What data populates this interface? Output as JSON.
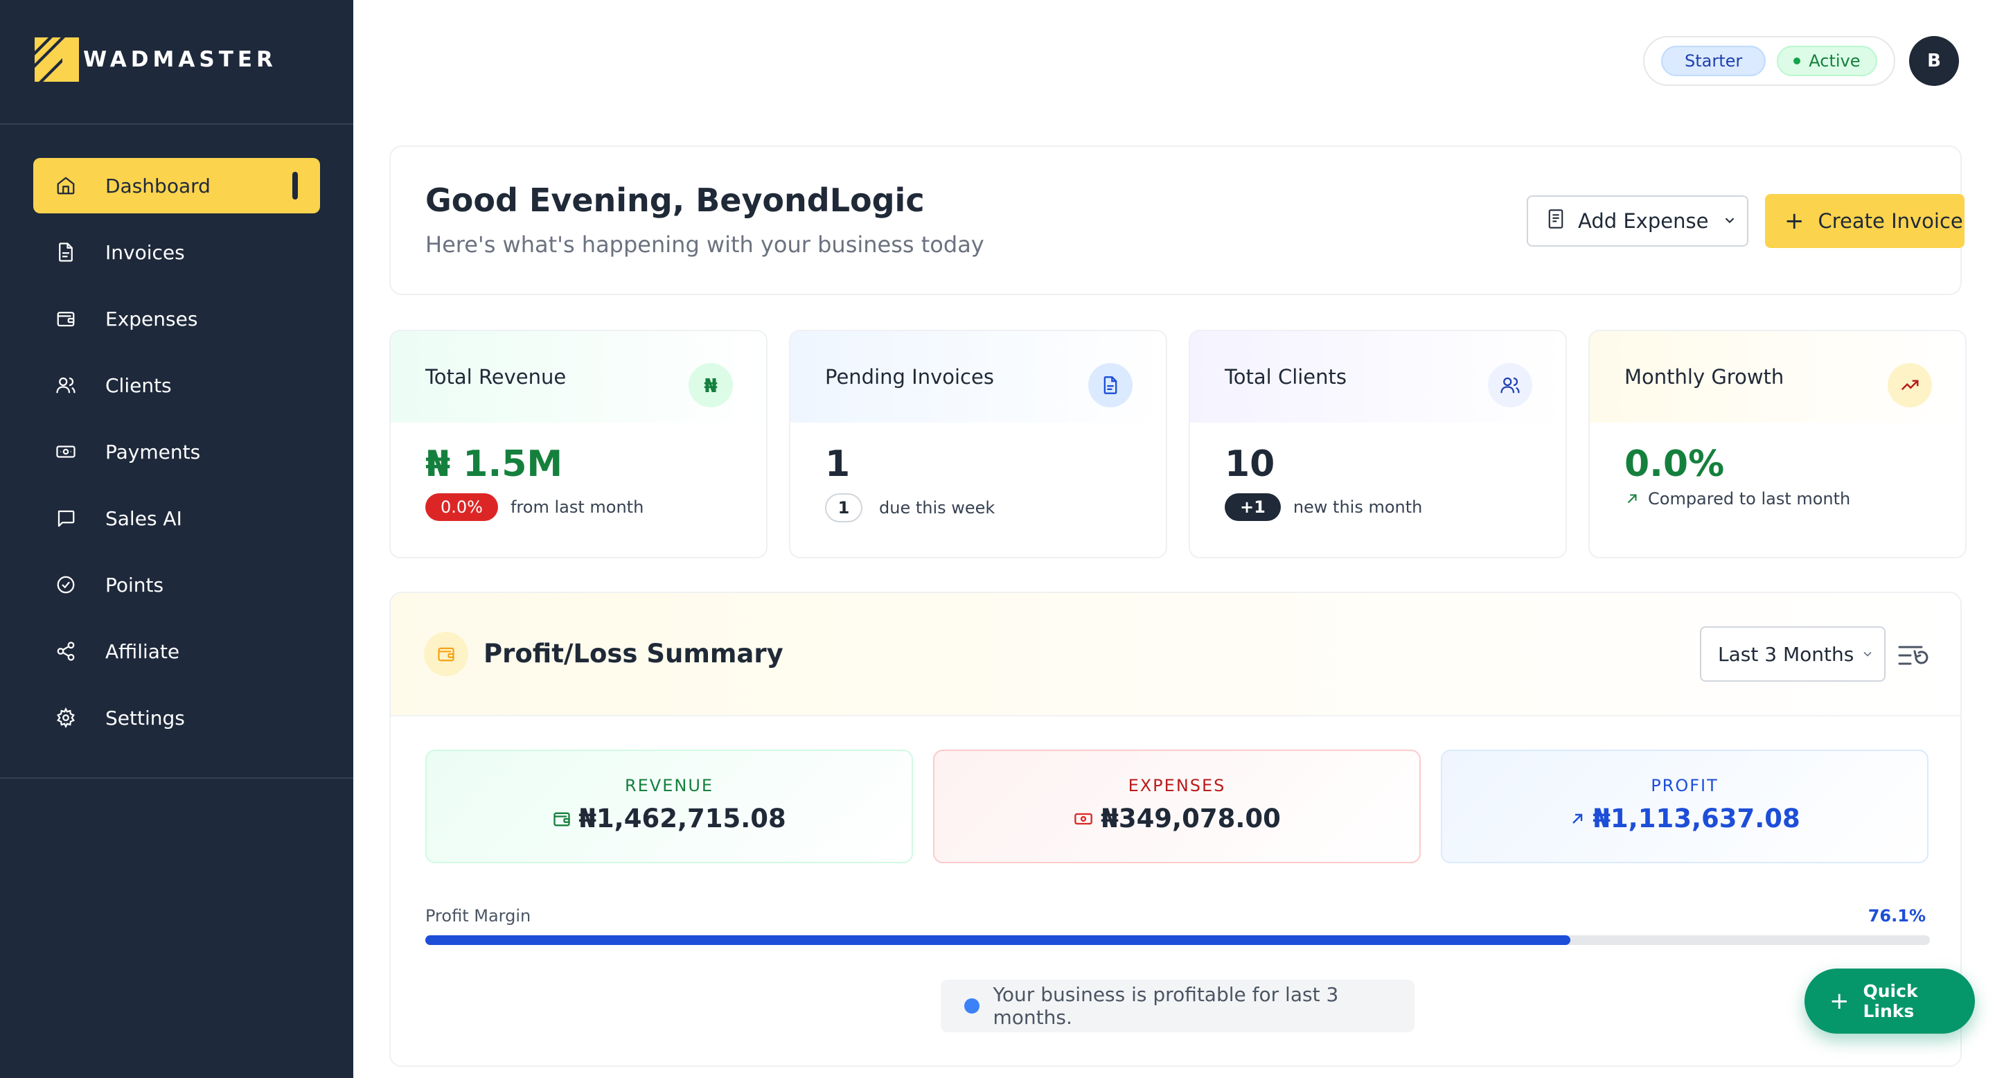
{
  "app": {
    "brand": "WADMASTER"
  },
  "sidebar": {
    "items": [
      {
        "label": "Dashboard",
        "icon": "home-icon",
        "active": true
      },
      {
        "label": "Invoices",
        "icon": "file-text-icon"
      },
      {
        "label": "Expenses",
        "icon": "wallet-icon"
      },
      {
        "label": "Clients",
        "icon": "users-icon"
      },
      {
        "label": "Payments",
        "icon": "banknote-icon"
      },
      {
        "label": "Sales AI",
        "icon": "message-square-icon"
      },
      {
        "label": "Points",
        "icon": "check-circle-icon"
      },
      {
        "label": "Affiliate",
        "icon": "share-icon"
      },
      {
        "label": "Settings",
        "icon": "gear-icon"
      }
    ]
  },
  "header": {
    "plan_badge": "Starter",
    "status_badge": "Active",
    "avatar_initial": "B"
  },
  "welcome": {
    "greeting": "Good Evening, BeyondLogic",
    "subtitle": "Here's what's happening with your business today",
    "add_expense_label": "Add Expense",
    "create_invoice_label": "Create Invoice"
  },
  "stats": [
    {
      "title": "Total Revenue",
      "value": "₦ 1.5M",
      "badge": "0.0%",
      "note": "from last month",
      "icon_text": "₦",
      "accent": "#15803d"
    },
    {
      "title": "Pending Invoices",
      "value": "1",
      "badge": "1",
      "note": "due this week",
      "accent": "#1f2937"
    },
    {
      "title": "Total Clients",
      "value": "10",
      "badge": "+1",
      "note": "new this month",
      "accent": "#1f2937"
    },
    {
      "title": "Monthly Growth",
      "value": "0.0%",
      "note": "Compared to last month",
      "accent": "#15803d"
    }
  ],
  "profit_loss": {
    "title": "Profit/Loss Summary",
    "period_select": "Last 3 Months",
    "revenue_label": "REVENUE",
    "revenue_value": "₦1,462,715.08",
    "expenses_label": "EXPENSES",
    "expenses_value": "₦349,078.00",
    "profit_label": "PROFIT",
    "profit_value": "₦1,113,637.08",
    "margin_label": "Profit Margin",
    "margin_pct": "76.1%",
    "margin_fraction": 0.761,
    "notice": "Your business is profitable for last 3 months."
  },
  "quick_links_label": "Quick Links",
  "colors": {
    "sidebar_bg": "#1e293b",
    "accent_yellow": "#fcd34d",
    "green": "#15803d",
    "red": "#dc2626",
    "blue": "#1d4ed8",
    "quick_links_bg": "#059669"
  }
}
